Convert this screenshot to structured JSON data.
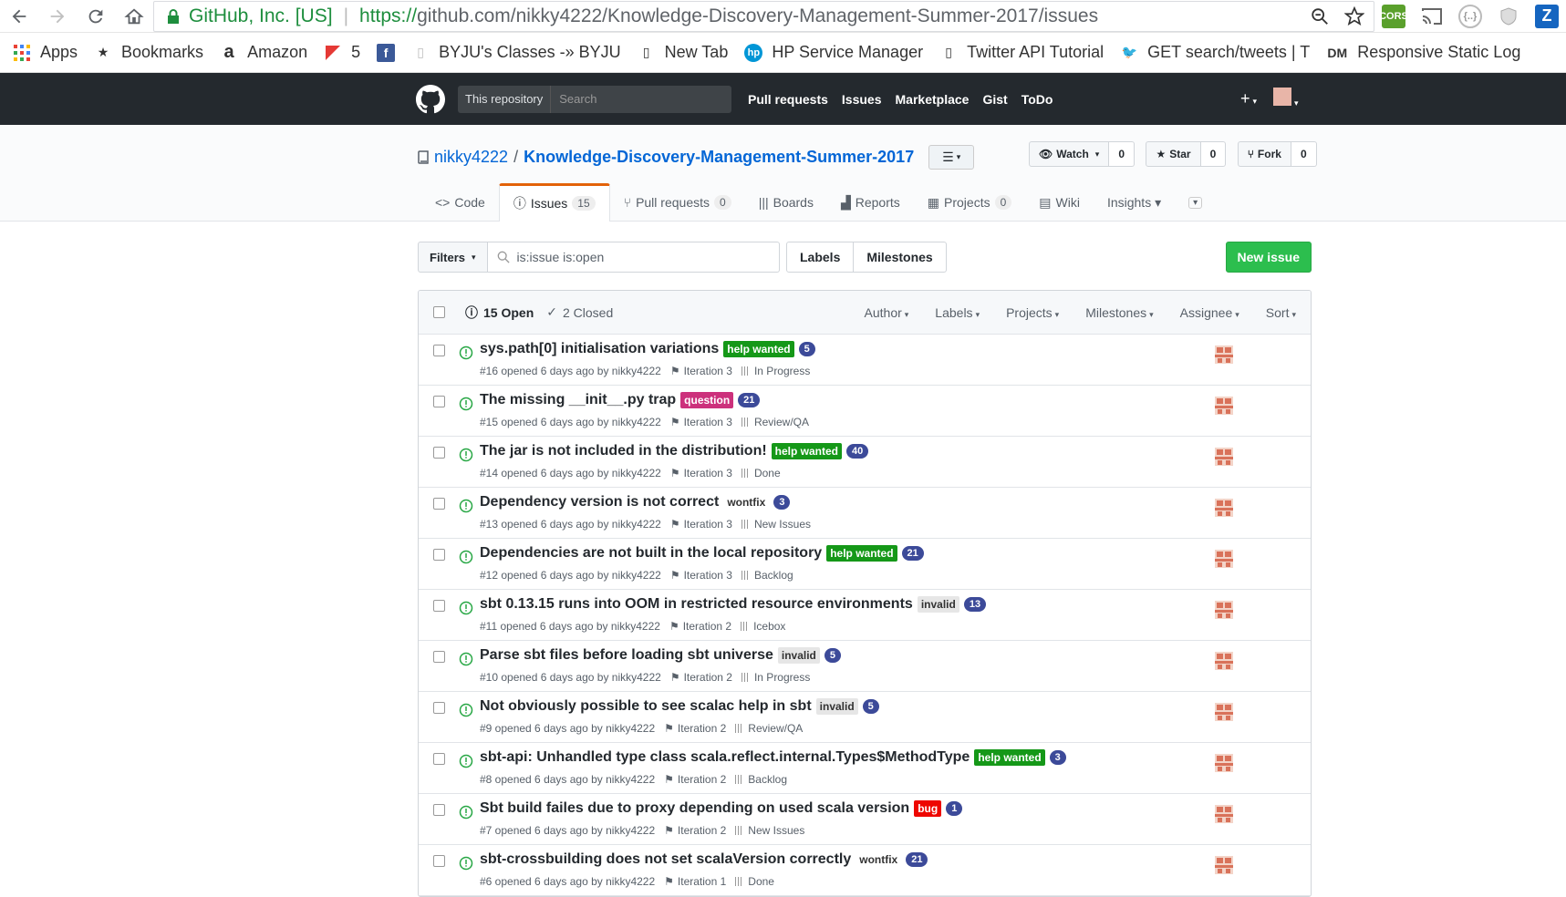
{
  "browser": {
    "secure_label": "GitHub, Inc. [US]",
    "url_proto": "https://",
    "url_rest": "github.com/nikky4222/Knowledge-Discovery-Management-Summer-2017/issues"
  },
  "bookmarks": [
    {
      "label": "Apps",
      "icon": "apps-grid-icon"
    },
    {
      "label": "Bookmarks",
      "icon": "star-icon"
    },
    {
      "label": "Amazon",
      "icon": "amazon-icon"
    },
    {
      "label": "5",
      "icon": "flag-icon"
    },
    {
      "label": "",
      "icon": "facebook-icon"
    },
    {
      "label": "BYJU's Classes -» BYJU",
      "icon": "byju-icon"
    },
    {
      "label": "New Tab",
      "icon": "page-icon"
    },
    {
      "label": "HP Service Manager",
      "icon": "hp-icon"
    },
    {
      "label": "Twitter API Tutorial",
      "icon": "page-icon"
    },
    {
      "label": "GET search/tweets | T",
      "icon": "twitter-icon"
    },
    {
      "label": "Responsive Static Log",
      "icon": "dm-icon"
    }
  ],
  "header": {
    "scope": "This repository",
    "search_placeholder": "Search",
    "nav": [
      "Pull requests",
      "Issues",
      "Marketplace",
      "Gist",
      "ToDo"
    ],
    "plus": "+"
  },
  "repo": {
    "owner": "nikky4222",
    "slash": "/",
    "name": "Knowledge-Discovery-Management-Summer-2017",
    "watch_label": "Watch",
    "watch_count": "0",
    "star_label": "Star",
    "star_count": "0",
    "fork_label": "Fork",
    "fork_count": "0"
  },
  "tabs": [
    {
      "label": "Code",
      "icon": "code-icon"
    },
    {
      "label": "Issues",
      "icon": "issue-icon",
      "count": "15",
      "selected": true
    },
    {
      "label": "Pull requests",
      "icon": "pr-icon",
      "count": "0"
    },
    {
      "label": "Boards",
      "icon": "boards-icon"
    },
    {
      "label": "Reports",
      "icon": "reports-icon"
    },
    {
      "label": "Projects",
      "icon": "project-icon",
      "count": "0"
    },
    {
      "label": "Wiki",
      "icon": "wiki-icon"
    },
    {
      "label": "Insights ▾",
      "icon": ""
    }
  ],
  "toolbar": {
    "filters_label": "Filters",
    "search_value": "is:issue is:open",
    "labels_label": "Labels",
    "milestones_label": "Milestones",
    "new_issue_label": "New issue"
  },
  "list_header": {
    "open_label": "15 Open",
    "closed_label": "2 Closed",
    "filters": [
      "Author",
      "Labels",
      "Projects",
      "Milestones",
      "Assignee",
      "Sort"
    ]
  },
  "issues": [
    {
      "title": "sys.path[0] initialisation variations",
      "label": "help wanted",
      "label_bg": "#159818",
      "label_fg": "#ffffff",
      "badge": "5",
      "meta": "#16 opened 6 days ago by nikky4222",
      "milestone": "Iteration 3",
      "pipeline": "In Progress"
    },
    {
      "title": "The missing __init__.py trap",
      "label": "question",
      "label_bg": "#cc317c",
      "label_fg": "#ffffff",
      "badge": "21",
      "meta": "#15 opened 6 days ago by nikky4222",
      "milestone": "Iteration 3",
      "pipeline": "Review/QA"
    },
    {
      "title": "The jar is not included in the distribution!",
      "label": "help wanted",
      "label_bg": "#159818",
      "label_fg": "#ffffff",
      "badge": "40",
      "meta": "#14 opened 6 days ago by nikky4222",
      "milestone": "Iteration 3",
      "pipeline": "Done"
    },
    {
      "title": "Dependency version is not correct",
      "label": "wontfix",
      "label_bg": "#ffffff",
      "label_fg": "#333333",
      "badge": "3",
      "meta": "#13 opened 6 days ago by nikky4222",
      "milestone": "Iteration 3",
      "pipeline": "New Issues"
    },
    {
      "title": "Dependencies are not built in the local repository",
      "label": "help wanted",
      "label_bg": "#159818",
      "label_fg": "#ffffff",
      "badge": "21",
      "meta": "#12 opened 6 days ago by nikky4222",
      "milestone": "Iteration 3",
      "pipeline": "Backlog"
    },
    {
      "title": "sbt 0.13.15 runs into OOM in restricted resource environments",
      "label": "invalid",
      "label_bg": "#e6e6e6",
      "label_fg": "#333333",
      "badge": "13",
      "meta": "#11 opened 6 days ago by nikky4222",
      "milestone": "Iteration 2",
      "pipeline": "Icebox"
    },
    {
      "title": "Parse sbt files before loading sbt universe",
      "label": "invalid",
      "label_bg": "#e6e6e6",
      "label_fg": "#333333",
      "badge": "5",
      "meta": "#10 opened 6 days ago by nikky4222",
      "milestone": "Iteration 2",
      "pipeline": "In Progress"
    },
    {
      "title": "Not obviously possible to see scalac help in sbt",
      "label": "invalid",
      "label_bg": "#e6e6e6",
      "label_fg": "#333333",
      "badge": "5",
      "meta": "#9 opened 6 days ago by nikky4222",
      "milestone": "Iteration 2",
      "pipeline": "Review/QA"
    },
    {
      "title": "sbt-api: Unhandled type class scala.reflect.internal.Types$MethodType",
      "label": "help wanted",
      "label_bg": "#159818",
      "label_fg": "#ffffff",
      "badge": "3",
      "meta": "#8 opened 6 days ago by nikky4222",
      "milestone": "Iteration 2",
      "pipeline": "Backlog"
    },
    {
      "title": "Sbt build failes due to proxy depending on used scala version",
      "label": "bug",
      "label_bg": "#ee0701",
      "label_fg": "#ffffff",
      "badge": "1",
      "meta": "#7 opened 6 days ago by nikky4222",
      "milestone": "Iteration 2",
      "pipeline": "New Issues"
    },
    {
      "title": "sbt-crossbuilding does not set scalaVersion correctly",
      "label": "wontfix",
      "label_bg": "#ffffff",
      "label_fg": "#333333",
      "badge": "21",
      "meta": "#6 opened 6 days ago by nikky4222",
      "milestone": "Iteration 1",
      "pipeline": "Done"
    }
  ],
  "colors": {
    "accent": "#0366d6",
    "header_bg": "#24292e",
    "open_green": "#28a745",
    "badge_blue": "#3c4a99",
    "tab_orange": "#e36209"
  }
}
